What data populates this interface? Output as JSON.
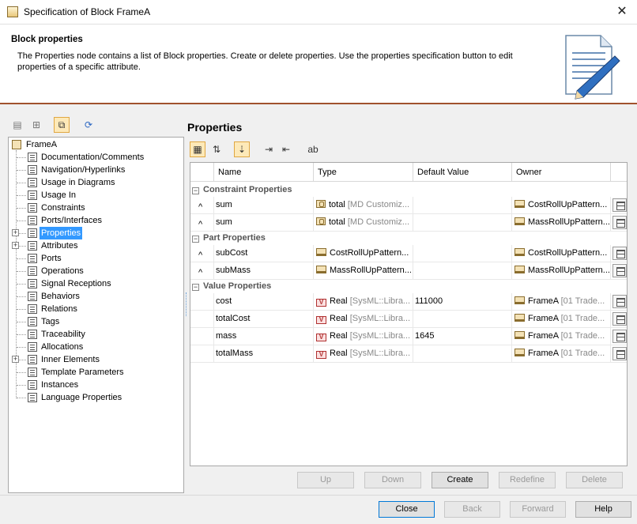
{
  "window": {
    "title": "Specification of Block FrameA",
    "close_glyph": "✕"
  },
  "header": {
    "title": "Block properties",
    "description": "The Properties node contains a list of Block properties. Create or delete properties. Use the properties specification button to edit properties of a specific attribute."
  },
  "left_toolbar": {
    "icons": [
      "list-icon",
      "tree-icon",
      "copy-icon",
      "refresh-icon"
    ]
  },
  "tree": {
    "root": "FrameA",
    "items": [
      {
        "label": "Documentation/Comments",
        "expandable": false
      },
      {
        "label": "Navigation/Hyperlinks",
        "expandable": false
      },
      {
        "label": "Usage in Diagrams",
        "expandable": false
      },
      {
        "label": "Usage In",
        "expandable": false
      },
      {
        "label": "Constraints",
        "expandable": false
      },
      {
        "label": "Ports/Interfaces",
        "expandable": false
      },
      {
        "label": "Properties",
        "expandable": true,
        "selected": true
      },
      {
        "label": "Attributes",
        "expandable": true
      },
      {
        "label": "Ports",
        "expandable": false
      },
      {
        "label": "Operations",
        "expandable": false
      },
      {
        "label": "Signal Receptions",
        "expandable": false
      },
      {
        "label": "Behaviors",
        "expandable": false
      },
      {
        "label": "Relations",
        "expandable": false
      },
      {
        "label": "Tags",
        "expandable": false
      },
      {
        "label": "Traceability",
        "expandable": false
      },
      {
        "label": "Allocations",
        "expandable": false
      },
      {
        "label": "Inner Elements",
        "expandable": true
      },
      {
        "label": "Template Parameters",
        "expandable": false
      },
      {
        "label": "Instances",
        "expandable": false
      },
      {
        "label": "Language Properties",
        "expandable": false
      }
    ]
  },
  "properties": {
    "title": "Properties",
    "columns": [
      "Name",
      "Type",
      "Default Value",
      "Owner"
    ],
    "groups": [
      {
        "label": "Constraint Properties",
        "rows": [
          {
            "marker": "^",
            "name": "sum",
            "type_icon": "constraint",
            "type": "total",
            "type_muted": "[MD Customiz...",
            "default": "",
            "owner": "CostRollUpPattern..."
          },
          {
            "marker": "^",
            "name": "sum",
            "type_icon": "constraint",
            "type": "total",
            "type_muted": "[MD Customiz...",
            "default": "",
            "owner": "MassRollUpPattern..."
          }
        ]
      },
      {
        "label": "Part Properties",
        "rows": [
          {
            "marker": "^",
            "name": "subCost",
            "type_icon": "block",
            "type": "CostRollUpPattern...",
            "type_muted": "",
            "default": "",
            "owner": "CostRollUpPattern..."
          },
          {
            "marker": "^",
            "name": "subMass",
            "type_icon": "block",
            "type": "MassRollUpPattern...",
            "type_muted": "",
            "default": "",
            "owner": "MassRollUpPattern..."
          }
        ]
      },
      {
        "label": "Value Properties",
        "rows": [
          {
            "marker": "",
            "name": "cost",
            "type_icon": "value",
            "type": "Real",
            "type_muted": "[SysML::Libra...",
            "default": "111000",
            "owner": "FrameA",
            "owner_muted": "[01 Trade..."
          },
          {
            "marker": "",
            "name": "totalCost",
            "type_icon": "value",
            "type": "Real",
            "type_muted": "[SysML::Libra...",
            "default": "",
            "owner": "FrameA",
            "owner_muted": "[01 Trade..."
          },
          {
            "marker": "",
            "name": "mass",
            "type_icon": "value",
            "type": "Real",
            "type_muted": "[SysML::Libra...",
            "default": "1645",
            "owner": "FrameA",
            "owner_muted": "[01 Trade..."
          },
          {
            "marker": "",
            "name": "totalMass",
            "type_icon": "value",
            "type": "Real",
            "type_muted": "[SysML::Libra...",
            "default": "",
            "owner": "FrameA",
            "owner_muted": "[01 Trade..."
          }
        ]
      }
    ]
  },
  "table_buttons": {
    "up": "Up",
    "down": "Down",
    "create": "Create",
    "redefine": "Redefine",
    "delete": "Delete"
  },
  "dialog_buttons": {
    "close": "Close",
    "back": "Back",
    "forward": "Forward",
    "help": "Help"
  },
  "colors": {
    "accent_border": "#a0522d",
    "selection": "#3399ff"
  }
}
